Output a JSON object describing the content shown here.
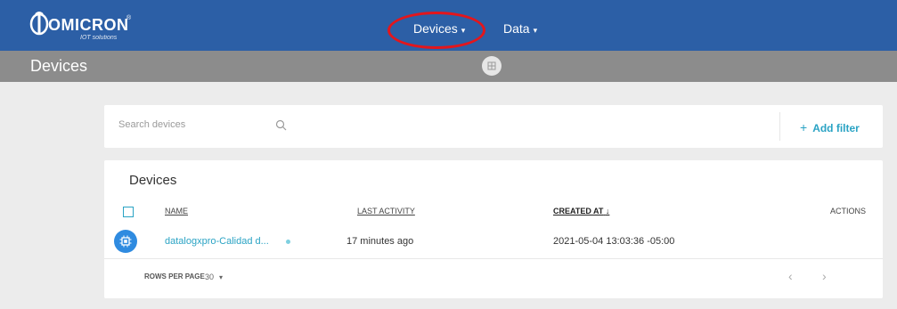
{
  "brand": {
    "name": "OMICRON",
    "registered": "®",
    "tagline": "IOT solutions"
  },
  "nav": {
    "devices_label": "Devices",
    "data_label": "Data",
    "caret": "▾"
  },
  "subheader": {
    "title": "Devices"
  },
  "search": {
    "placeholder": "Search devices",
    "add_filter_label": "Add filter",
    "add_filter_plus": "+"
  },
  "devices": {
    "title": "Devices",
    "columns": {
      "name": "NAME",
      "last_activity": "LAST ACTIVITY",
      "created_at": "CREATED AT",
      "sort_arrow": "↓",
      "actions": "ACTIONS"
    },
    "rows": [
      {
        "name": "datalogxpro-Calidad d...",
        "last_activity": "17 minutes ago",
        "created_at": "2021-05-04 13:03:36 -05:00"
      }
    ],
    "footer": {
      "rows_per_page_label": "ROWS PER PAGE",
      "rows_per_page_value": "30",
      "prev": "‹",
      "next": "›"
    }
  },
  "colors": {
    "topbar": "#2c5fa6",
    "subbar": "#8c8c8c",
    "accent": "#2aa3c4",
    "highlight": "#e3161c",
    "device_icon": "#2f8be0"
  }
}
